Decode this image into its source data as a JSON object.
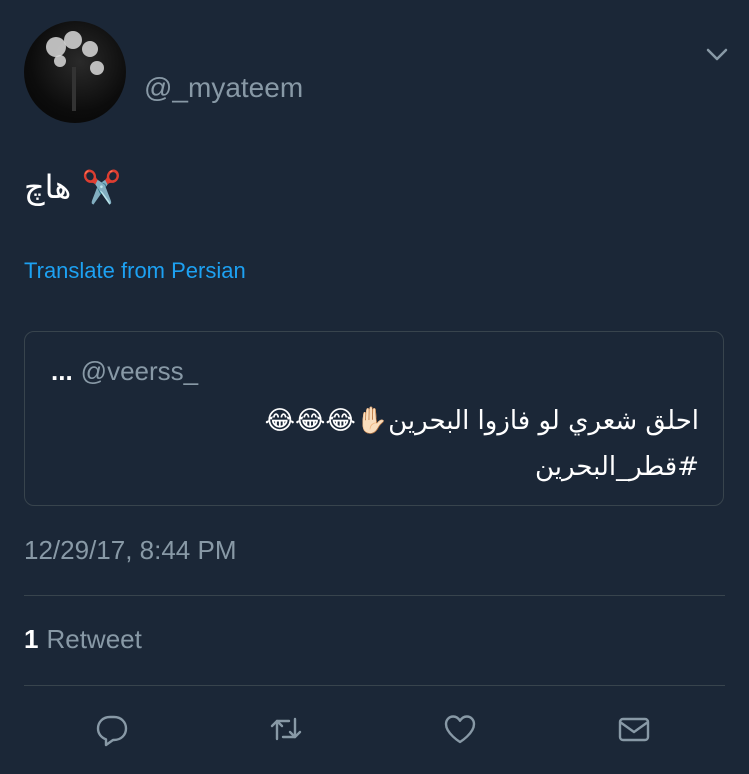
{
  "tweet": {
    "username": "@_myateem",
    "text": "هاچ ✂️",
    "translate_label": "Translate from Persian",
    "timestamp": "12/29/17, 8:44 PM"
  },
  "quoted_tweet": {
    "ellipsis": "...",
    "author": "@veerss_",
    "line1": "احلق شعري لو فازوا البحرين✋🏻😂😂😂",
    "line2": "#قطر_البحرين"
  },
  "stats": {
    "retweet_count": "1",
    "retweet_label": "Retweet"
  },
  "icons": {
    "menu": "chevron-down-icon",
    "reply": "reply-icon",
    "retweet": "retweet-icon",
    "like": "heart-icon",
    "message": "envelope-icon"
  },
  "colors": {
    "background": "#1b2737",
    "secondary_text": "#8899a6",
    "link": "#1da1f2",
    "divider": "#38444d"
  }
}
